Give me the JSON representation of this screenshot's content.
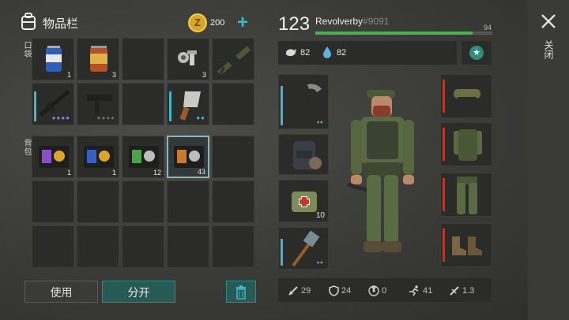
{
  "header": {
    "title": "物品栏",
    "coins": "200",
    "add": "+"
  },
  "side_labels": {
    "pockets": "口袋",
    "backpack": "背包"
  },
  "inventory": {
    "pocket_cells": [
      {
        "item": "soda-can",
        "count": "1"
      },
      {
        "item": "canned-food",
        "count": "3"
      },
      {
        "item": "",
        "count": ""
      },
      {
        "item": "nuts-bolts",
        "count": "3"
      },
      {
        "item": "grenade-launcher",
        "count": ""
      },
      {
        "item": "assault-rifle",
        "count": ""
      },
      {
        "item": "uzi",
        "count": ""
      },
      {
        "item": "",
        "count": ""
      },
      {
        "item": "cleaver",
        "count": ""
      },
      {
        "item": "",
        "count": ""
      }
    ],
    "backpack_cells": [
      {
        "item": "police-badge-purple",
        "count": "1"
      },
      {
        "item": "police-badge-blue",
        "count": "1"
      },
      {
        "item": "police-badge-green",
        "count": "12"
      },
      {
        "item": "police-badge-orange",
        "count": "43"
      },
      {
        "item": "",
        "count": ""
      }
    ]
  },
  "buttons": {
    "use": "使用",
    "split": "分开"
  },
  "player": {
    "level": "123",
    "name": "Revolverby",
    "tag": "#9091",
    "xp": "94",
    "xp_fraction": 0.89,
    "hunger": "82",
    "thirst": "82"
  },
  "equipment": {
    "pickaxe_count": "",
    "medkit_count": "10"
  },
  "stats": {
    "attack": "29",
    "defense": "24",
    "radiation": "0",
    "speed": "41",
    "weight": "1.3"
  },
  "close_label": "关闭",
  "colors": {
    "accent": "#2f8c7e",
    "xp_bar": "#4caf50",
    "durability": "#3fb7c8"
  }
}
